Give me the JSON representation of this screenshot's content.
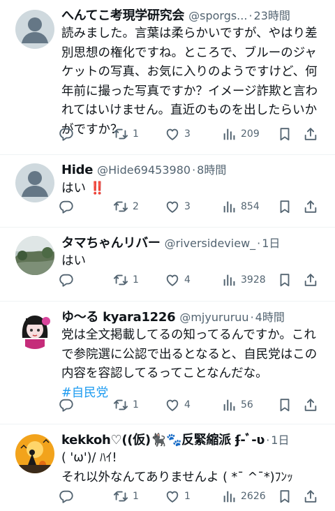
{
  "tweets": [
    {
      "name": "へんてこ考現学研究会",
      "handle": "@sporgs...",
      "time": "23時間",
      "text": "読みました。言葉は柔らかいですが、やはり差別思想の権化ですね。ところで、ブルーのジャケットの写真、お気に入りのようですけど、何年前に撮った写真ですか？イメージ詐欺と言われてはいけません。直近のものを出したらいかがですか？",
      "hashtag": "",
      "replies": "",
      "retweets": "1",
      "likes": "3",
      "views": "209",
      "avatar": "default"
    },
    {
      "name": "Hide",
      "handle": "@Hide69453980",
      "time": "8時間",
      "text": "はい ‼️",
      "hashtag": "",
      "replies": "",
      "retweets": "2",
      "likes": "3",
      "views": "854",
      "avatar": "default"
    },
    {
      "name": "タマちゃんリバー",
      "handle": "@riversideview_",
      "time": "1日",
      "text": "はい",
      "hashtag": "",
      "replies": "",
      "retweets": "1",
      "likes": "4",
      "views": "3928",
      "avatar": "landscape"
    },
    {
      "name": "ゆ〜る kyara1226",
      "handle": "@mjyururuu",
      "time": "4時間",
      "text": "党は全文掲載してるの知ってるんですか。これで参院選に公認で出るとなると、自民党はこの内容を容認してるってことなんだな。",
      "hashtag": "#自民党",
      "replies": "",
      "retweets": "1",
      "likes": "4",
      "views": "56",
      "avatar": "character"
    },
    {
      "name": "kekkoh♡((仮)🐈‍⬛🐾反緊縮派 ʄ-ﾞ-ʋ",
      "handle": "",
      "time": "1日",
      "text": "( 'ω')/ ﾊｲ!\nそれ以外なんてありませんよ ( *¯ ^¯*)ﾌﾝｯ",
      "hashtag": "",
      "replies": "",
      "retweets": "1",
      "likes": "1",
      "views": "2626",
      "avatar": "halloween"
    }
  ],
  "more_icon": "ellipsis-icon",
  "colors": {
    "secondary": "#536471",
    "link": "#1d9bf0",
    "avatar_default": "#cfd9de",
    "divider": "#eff3f4"
  }
}
